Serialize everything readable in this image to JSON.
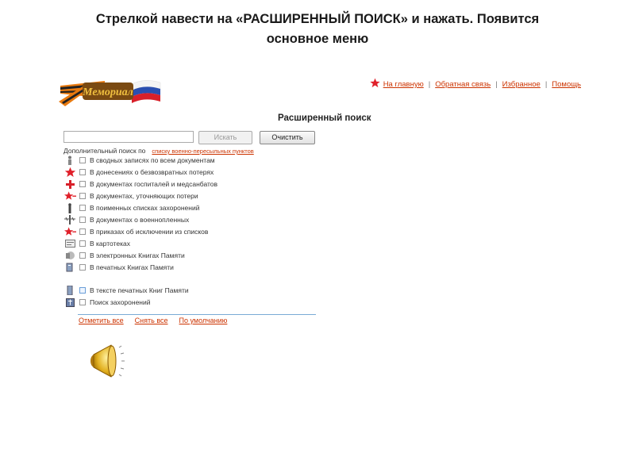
{
  "slide": {
    "title_line1": "Стрелкой навести на «РАСШИРЕННЫЙ ПОИСК» и нажать. Появится",
    "title_line2": "основное меню"
  },
  "logo": {
    "text": "Мемориал"
  },
  "nav": {
    "home": "На главную",
    "feedback": "Обратная связь",
    "favorites": "Избранное",
    "help": "Помощь",
    "separator": "|"
  },
  "page": {
    "heading": "Расширенный поиск"
  },
  "search": {
    "value": "",
    "placeholder": "",
    "search_button": "Искать",
    "clear_button": "Очистить"
  },
  "extra": {
    "label": "Дополнительный поиск по",
    "link": "списку военно-пересыльных пунктов"
  },
  "options": [
    {
      "label": "В сводных записях по всем документам",
      "icon": "soldier-icon"
    },
    {
      "label": "В донесениях о безвозвратных потерях",
      "icon": "red-star-icon"
    },
    {
      "label": "В документах госпиталей и медсанбатов",
      "icon": "red-cross-icon"
    },
    {
      "label": "В документах, уточняющих потери",
      "icon": "star-arrow-icon"
    },
    {
      "label": "В поименных списках захоронений",
      "icon": "grave-marker-icon"
    },
    {
      "label": "В документах о военнопленных",
      "icon": "barbed-wire-icon"
    },
    {
      "label": "В приказах об исключении из списков",
      "icon": "star-arrow-icon"
    },
    {
      "label": "В картотеках",
      "icon": "card-file-icon"
    },
    {
      "label": "В электронных Книгах Памяти",
      "icon": "e-book-icon"
    },
    {
      "label": "В печатных Книгах Памяти",
      "icon": "printed-book-icon"
    }
  ],
  "options_extra": [
    {
      "label": "В тексте печатных Книг Памяти",
      "icon": "book-text-icon"
    },
    {
      "label": "Поиск захоронений",
      "icon": "burial-search-icon"
    }
  ],
  "footer": {
    "select_all": "Отметить все",
    "deselect_all": "Снять все",
    "default": "По умолчанию"
  },
  "colors": {
    "link": "#cc3300",
    "star": "#e0202a",
    "divider": "#7aaad6"
  }
}
